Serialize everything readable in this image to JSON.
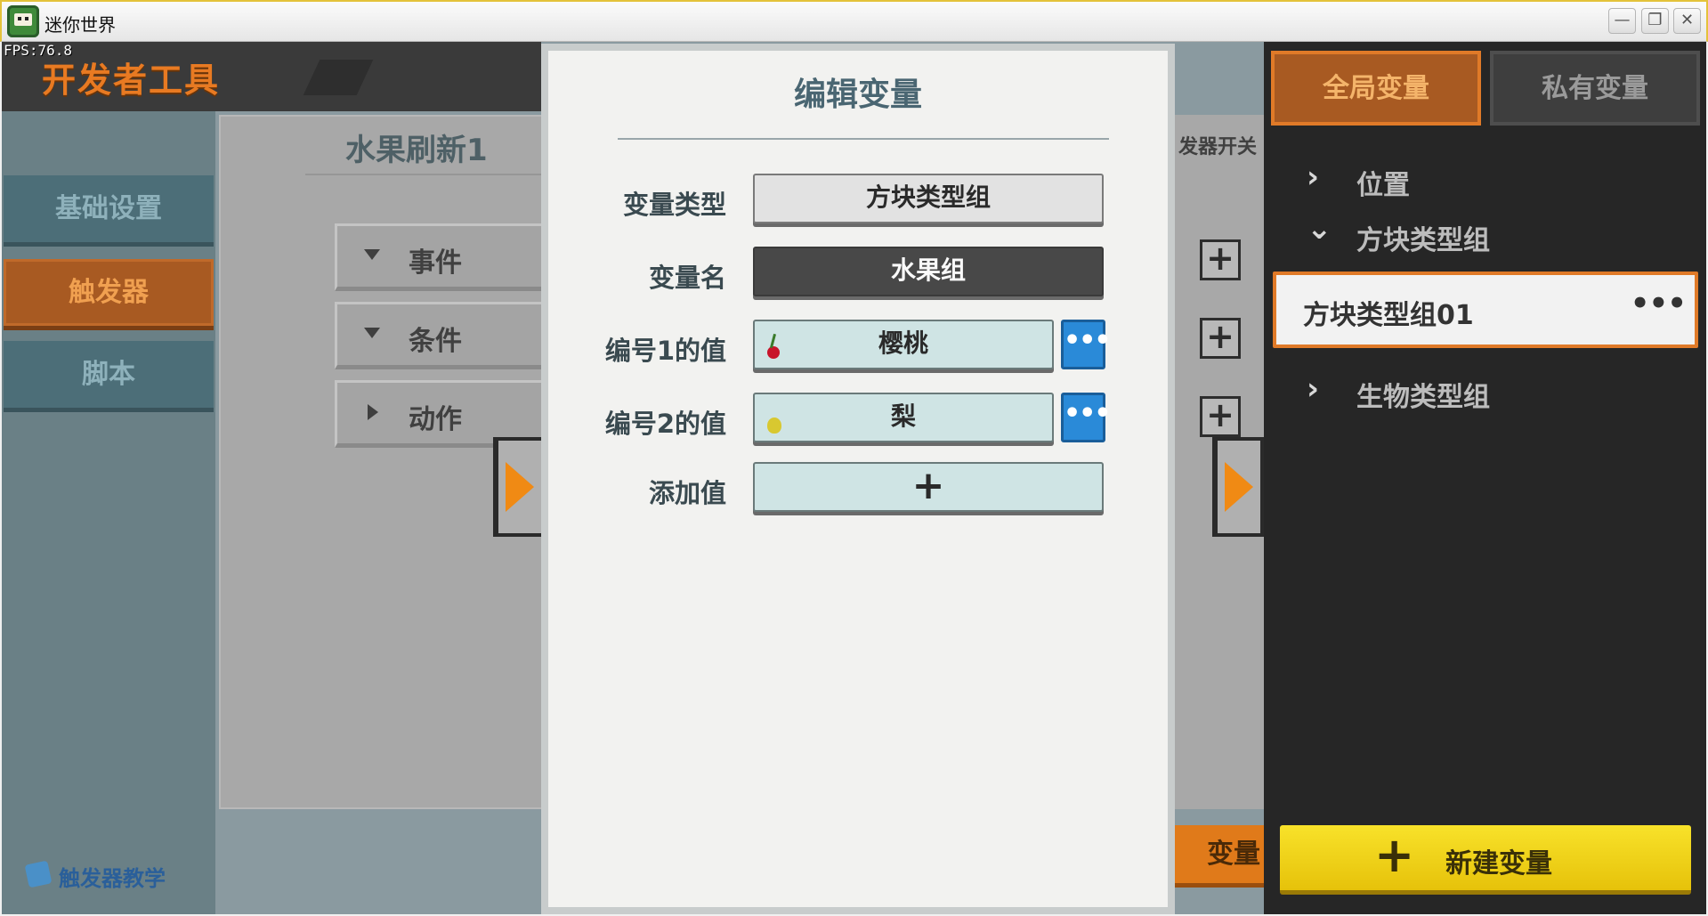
{
  "window": {
    "title": "迷你世界",
    "minimize": "—",
    "restore": "❐",
    "close": "✕"
  },
  "hud": {
    "fps": "FPS:76.8"
  },
  "devtools": {
    "title": "开发者工具",
    "sidebar": [
      {
        "label": "基础设置",
        "active": false
      },
      {
        "label": "触发器",
        "active": true
      },
      {
        "label": "脚本",
        "active": false
      }
    ],
    "help_link": "触发器教学"
  },
  "rule": {
    "title": "水果刷新1",
    "rows": [
      {
        "label": "事件",
        "arrow": "down"
      },
      {
        "label": "条件",
        "arrow": "down"
      },
      {
        "label": "动作",
        "arrow": "right"
      }
    ],
    "right_strip_label": "发器开关",
    "plus": "+",
    "variable_button": "变量"
  },
  "dialog": {
    "title": "编辑变量",
    "fields": {
      "type_label": "变量类型",
      "type_value": "方块类型组",
      "name_label": "变量名",
      "name_value": "水果组",
      "value1_label": "编号1的值",
      "value1": "樱桃",
      "value2_label": "编号2的值",
      "value2": "梨",
      "add_label": "添加值",
      "add_symbol": "+",
      "more_symbol": "•••"
    },
    "icons": {
      "value1_icon": "cherry-icon",
      "value2_icon": "pear-icon"
    }
  },
  "variables": {
    "tabs": {
      "global": "全局变量",
      "private": "私有变量"
    },
    "tree": {
      "position": "位置",
      "block_group": "方块类型组",
      "block_group_item": "方块类型组01",
      "creature_group": "生物类型组",
      "collapsed_chevron": "›",
      "expanded_chevron": "⌄",
      "item_more": "•••"
    },
    "new_button": {
      "plus": "+",
      "label": "新建变量"
    }
  },
  "colors": {
    "accent_orange": "#e07a28",
    "sidebar_teal": "#4c6e78",
    "new_button_yellow": "#f0d018",
    "more_button_blue": "#2a8ad8"
  }
}
